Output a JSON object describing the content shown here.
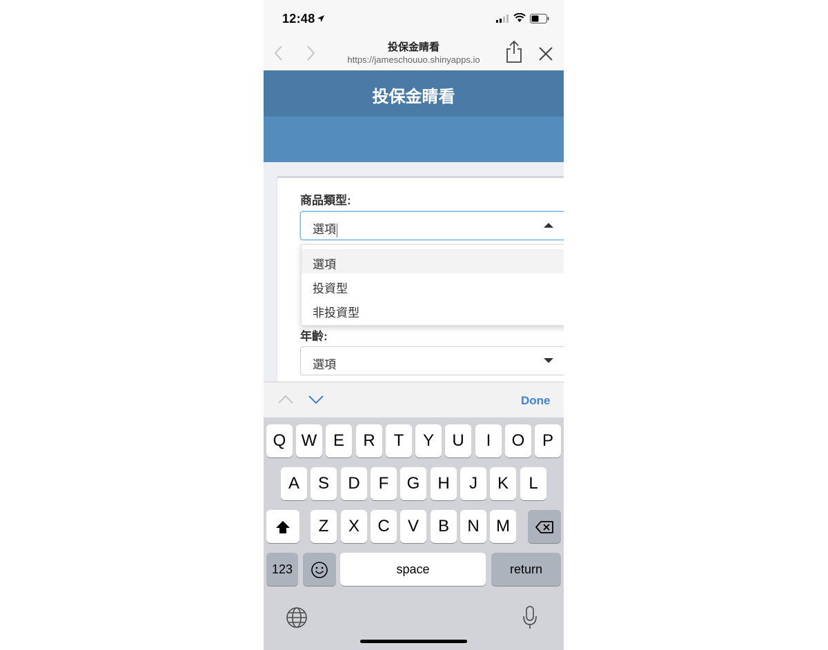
{
  "status_bar": {
    "time": "12:48"
  },
  "browser": {
    "title": "投保金睛看",
    "url": "https://jameschouuo.shinyapps.io"
  },
  "app": {
    "header_title": "投保金睛看",
    "fields": {
      "product_type": {
        "label": "商品類型:",
        "selected": "選項",
        "options": [
          "選項",
          "投資型",
          "非投資型"
        ]
      },
      "age": {
        "label": "年齡:",
        "selected": "選項"
      }
    }
  },
  "accessory": {
    "done_label": "Done"
  },
  "keyboard": {
    "row1": [
      "Q",
      "W",
      "E",
      "R",
      "T",
      "Y",
      "U",
      "I",
      "O",
      "P"
    ],
    "row2": [
      "A",
      "S",
      "D",
      "F",
      "G",
      "H",
      "J",
      "K",
      "L"
    ],
    "row3": [
      "Z",
      "X",
      "C",
      "V",
      "B",
      "N",
      "M"
    ],
    "numbers_label": "123",
    "space_label": "space",
    "return_label": "return"
  },
  "colors": {
    "header": "#4a7ba7",
    "header_sub": "#548cbd",
    "accent": "#3e82d4"
  },
  "icons": [
    "location-arrow-icon",
    "cellular-signal-icon",
    "wifi-icon",
    "battery-icon",
    "back-chevron-icon",
    "forward-chevron-icon",
    "share-icon",
    "close-icon",
    "caret-up-icon",
    "caret-down-icon",
    "prev-field-icon",
    "next-field-icon",
    "shift-icon",
    "backspace-icon",
    "emoji-icon",
    "globe-icon",
    "microphone-icon"
  ]
}
